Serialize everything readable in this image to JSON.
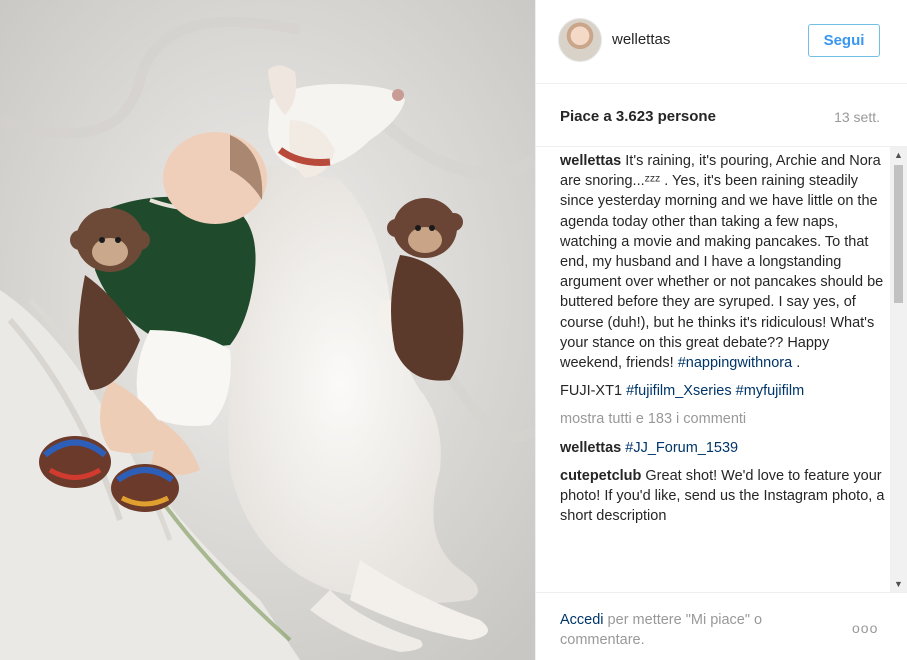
{
  "post": {
    "username": "wellettas",
    "follow_label": "Segui",
    "likes": "Piace a 3.623 persone",
    "date": "13 sett."
  },
  "comments": [
    {
      "user": "wellettas",
      "text": " It's raining, it's pouring, Archie and Nora are snoring...ᶻᶻᶻ . Yes, it's been raining steadily since yesterday morning and we have little on the agenda today other than taking a few naps, watching a movie and making pancakes. To that end, my husband and I have a longstanding argument over whether or not pancakes should be buttered before they are syruped. I say yes, of course (duh!), but he thinks it's ridiculous! What's your stance on this great debate?? Happy weekend, friends! ",
      "hashtag": "#nappingwithnora",
      "suffix": " ."
    },
    {
      "prefix": "FUJI-XT1 ",
      "hashtag1": "#fujifilm_Xseries",
      "hashtag2": "#myfujifilm"
    }
  ],
  "show_all": "mostra tutti e 183 i commenti",
  "comment2": {
    "user": "wellettas",
    "hashtag": "#JJ_Forum_1539"
  },
  "comment3": {
    "user": "cutepetclub",
    "text": " Great shot! We'd love to feature your photo! If you'd like, send us the Instagram photo, a short description"
  },
  "footer": {
    "login": "Accedi",
    "rest": " per mettere \"Mi piace\" o commentare.",
    "more": "ooo"
  },
  "icons": {
    "scroll_up": "▲",
    "scroll_down": "▼"
  },
  "colors": {
    "link": "#003569",
    "follow": "#3897f0",
    "muted": "#999999"
  }
}
